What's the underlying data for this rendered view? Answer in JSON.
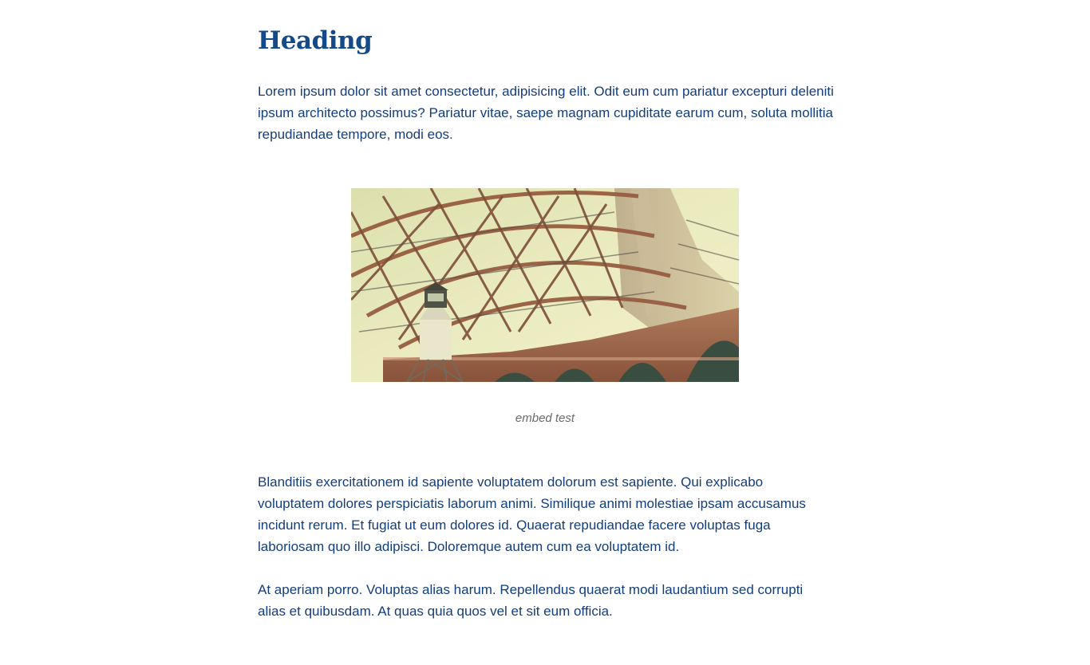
{
  "article": {
    "heading": "Heading",
    "paragraphs": [
      "Lorem ipsum dolor sit amet consectetur, adipisicing elit. Odit eum cum pariatur excepturi deleniti ipsum architecto possimus? Pariatur vitae, saepe magnam cupiditate earum cum, soluta mollitia repudiandae tempore, modi eos.",
      "Blanditiis exercitationem id sapiente voluptatem dolorum est sapiente. Qui explicabo voluptatem dolores perspiciatis laborum animi. Similique animi molestiae ipsam accusamus incidunt rerum. Et fugiat ut eum dolores id. Quaerat repudiandae facere voluptas fuga laboriosam quo illo adipisci. Doloremque autem cum ea voluptatem id.",
      "At aperiam porro. Voluptas alias harum. Repellendus quaerat modi laudantium sed corrupti alias et quibusdam. At quas quia quos vel et sit eum officia."
    ],
    "figure": {
      "caption": "embed test"
    }
  },
  "colors": {
    "text": "#123e7c",
    "heading": "#154a8a",
    "caption": "#6a6a6a",
    "background": "#ffffff"
  }
}
